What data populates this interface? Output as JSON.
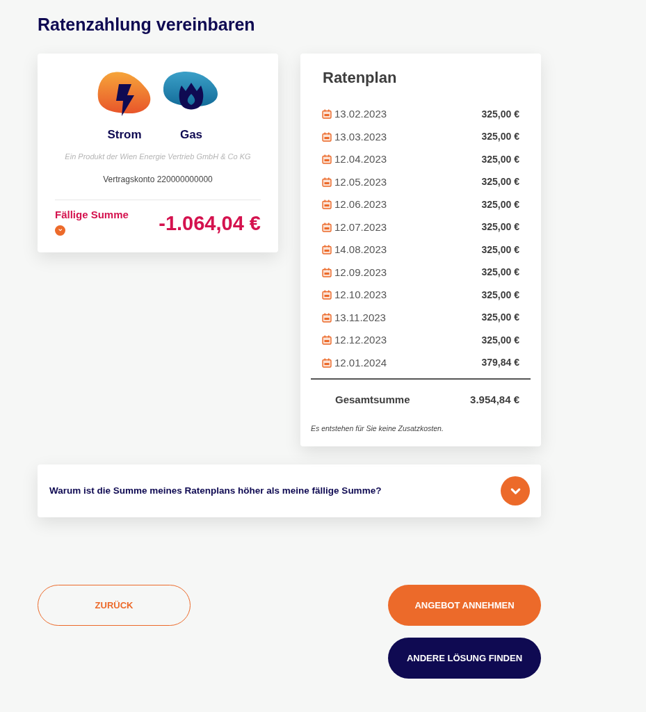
{
  "title": "Ratenzahlung vereinbaren",
  "account_card": {
    "products": [
      {
        "kind": "electricity",
        "label": "Strom"
      },
      {
        "kind": "gas",
        "label": "Gas"
      }
    ],
    "provider_note": "Ein Produkt der Wien Energie Vertrieb GmbH & Co KG",
    "account": "Vertragskonto 220000000000",
    "due_label": "Fällige Summe",
    "due_expanded": false,
    "due_amount": "-1.064,04 €"
  },
  "plan": {
    "title": "Ratenplan",
    "rows": [
      {
        "date": "13.02.2023",
        "amount": "325,00 €"
      },
      {
        "date": "13.03.2023",
        "amount": "325,00 €"
      },
      {
        "date": "12.04.2023",
        "amount": "325,00 €"
      },
      {
        "date": "12.05.2023",
        "amount": "325,00 €"
      },
      {
        "date": "12.06.2023",
        "amount": "325,00 €"
      },
      {
        "date": "12.07.2023",
        "amount": "325,00 €"
      },
      {
        "date": "14.08.2023",
        "amount": "325,00 €"
      },
      {
        "date": "12.09.2023",
        "amount": "325,00 €"
      },
      {
        "date": "12.10.2023",
        "amount": "325,00 €"
      },
      {
        "date": "13.11.2023",
        "amount": "325,00 €"
      },
      {
        "date": "12.12.2023",
        "amount": "325,00 €"
      },
      {
        "date": "12.01.2024",
        "amount": "379,84 €"
      }
    ],
    "total_label": "Gesamtsumme",
    "total": "3.954,84 €",
    "note": "Es entstehen für Sie keine Zusatzkosten."
  },
  "faq": {
    "question": "Warum ist die Summe meines Ratenplans höher als meine fällige Summe?",
    "expanded": false
  },
  "buttons": {
    "back": "ZURÜCK",
    "accept": "ANGEBOT ANNEHMEN",
    "other": "ANDERE LÖSUNG FINDEN"
  }
}
